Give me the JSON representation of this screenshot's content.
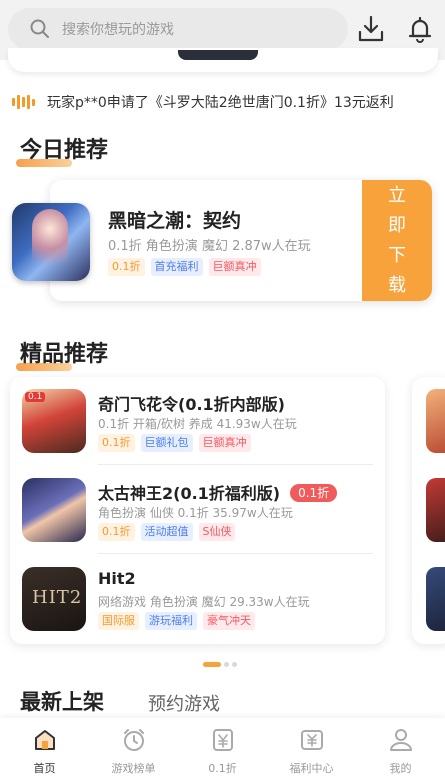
{
  "search": {
    "placeholder": "搜索你想玩的游戏"
  },
  "ticker": {
    "text": "玩家p**0申请了《斗罗大陆2绝世唐门0.1折》13元返利"
  },
  "today": {
    "section_title": "今日推荐",
    "game": {
      "name": "黑暗之潮：契约",
      "meta": "0.1折 角色扮演 魔幻  2.87w人在玩",
      "tags": [
        {
          "text": "0.1折",
          "style": "o"
        },
        {
          "text": "首充福利",
          "style": "b"
        },
        {
          "text": "巨额真冲",
          "style": "r"
        }
      ],
      "download_label": [
        "立",
        "即",
        "下",
        "载"
      ]
    }
  },
  "boutique": {
    "section_title": "精品推荐",
    "games": [
      {
        "name": "奇门飞花令(0.1折内部版)",
        "badge": "",
        "meta": "0.1折 开箱/砍树 养成  41.93w人在玩",
        "tags": [
          {
            "text": "0.1折",
            "style": "o"
          },
          {
            "text": "巨额礼包",
            "style": "b"
          },
          {
            "text": "巨额真冲",
            "style": "r"
          }
        ]
      },
      {
        "name": "太古神王2(0.1折福利版)",
        "badge": "0.1折",
        "meta": "角色扮演 仙侠 0.1折  35.97w人在玩",
        "tags": [
          {
            "text": "0.1折",
            "style": "o"
          },
          {
            "text": "活动超值",
            "style": "b"
          },
          {
            "text": "S仙侠",
            "style": "r"
          }
        ]
      },
      {
        "name": "Hit2",
        "badge": "",
        "meta": "网络游戏 角色扮演 魔幻  29.33w人在玩",
        "tags": [
          {
            "text": "国际服",
            "style": "o"
          },
          {
            "text": "游玩福利",
            "style": "b"
          },
          {
            "text": "豪气冲天",
            "style": "r"
          }
        ]
      }
    ]
  },
  "tabs": {
    "newest": "最新上架",
    "preorder": "预约游戏"
  },
  "nav": {
    "items": [
      {
        "label": "首页",
        "icon": "home-icon",
        "active": true
      },
      {
        "label": "游戏榜单",
        "icon": "alarm-clock-icon",
        "active": false
      },
      {
        "label": "0.1折",
        "icon": "yuan-coin-icon",
        "active": false
      },
      {
        "label": "福利中心",
        "icon": "welfare-icon",
        "active": false
      },
      {
        "label": "我的",
        "icon": "user-icon",
        "active": false
      }
    ]
  },
  "colors": {
    "accent": "#f7a23a",
    "tag_orange": "#f29a33",
    "tag_blue": "#4c7df0",
    "tag_red": "#f05a63"
  }
}
